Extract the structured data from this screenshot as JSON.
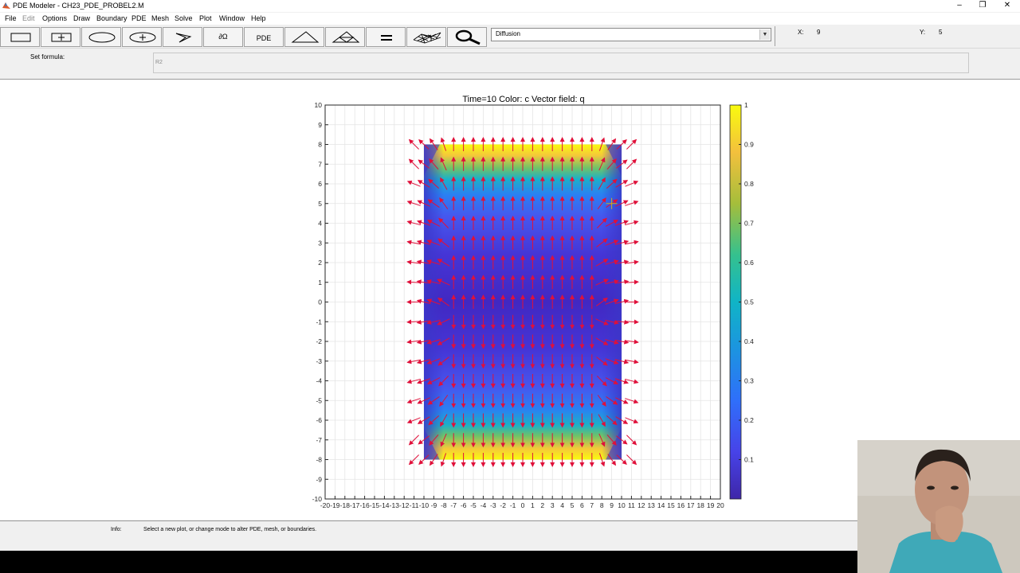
{
  "window": {
    "title": "PDE Modeler - CH23_PDE_PROBEL2.M",
    "controls": [
      "–",
      "❐",
      "✕"
    ]
  },
  "menubar": {
    "items": [
      "File",
      "Edit",
      "Options",
      "Draw",
      "Boundary",
      "PDE",
      "Mesh",
      "Solve",
      "Plot",
      "Window",
      "Help"
    ]
  },
  "toolbar": {
    "buttons": [
      {
        "name": "draw-rectangle-button",
        "icon": "rectangle-icon"
      },
      {
        "name": "draw-centered-rectangle-button",
        "icon": "centered-rectangle-icon"
      },
      {
        "name": "draw-ellipse-button",
        "icon": "ellipse-icon"
      },
      {
        "name": "draw-centered-ellipse-button",
        "icon": "centered-ellipse-icon"
      },
      {
        "name": "draw-polygon-button",
        "icon": "polygon-icon"
      },
      {
        "name": "boundary-mode-button",
        "icon": "boundary-icon",
        "label": "∂Ω"
      },
      {
        "name": "pde-specification-button",
        "icon": "pde-icon",
        "label": "PDE"
      },
      {
        "name": "initialize-mesh-button",
        "icon": "triangle-mesh-icon"
      },
      {
        "name": "refine-mesh-button",
        "icon": "refined-mesh-icon"
      },
      {
        "name": "solve-pde-button",
        "icon": "equals-icon"
      },
      {
        "name": "plot-solution-button",
        "icon": "surface-plot-icon"
      },
      {
        "name": "zoom-button",
        "icon": "zoom-icon"
      }
    ],
    "application_mode": "Diffusion"
  },
  "coordinates": {
    "x_label": "X:",
    "x_value": "9",
    "y_label": "Y:",
    "y_value": "5"
  },
  "formula": {
    "label": "Set formula:",
    "value": "R2"
  },
  "plot": {
    "title": "Time=10   Color: c   Vector field: q",
    "colorbar_ticks": [
      "0.1",
      "0.2",
      "0.3",
      "0.4",
      "0.5",
      "0.6",
      "0.7",
      "0.8",
      "0.9",
      "1"
    ],
    "arrow_color": "#e0103a",
    "cursor_color": "#c8b020"
  },
  "chart_data": {
    "type": "heatmap",
    "title": "Time=10   Color: c   Vector field: q",
    "xlabel": "",
    "ylabel": "",
    "xlim": [
      -20,
      20
    ],
    "ylim": [
      -10,
      10
    ],
    "x_ticks": [
      -20,
      -19,
      -18,
      -17,
      -16,
      -15,
      -14,
      -13,
      -12,
      -11,
      -10,
      -9,
      -8,
      -7,
      -6,
      -5,
      -4,
      -3,
      -2,
      -1,
      0,
      1,
      2,
      3,
      4,
      5,
      6,
      7,
      8,
      9,
      10,
      11,
      12,
      13,
      14,
      15,
      16,
      17,
      18,
      19,
      20
    ],
    "y_ticks": [
      -10,
      -9,
      -8,
      -7,
      -6,
      -5,
      -4,
      -3,
      -2,
      -1,
      0,
      1,
      2,
      3,
      4,
      5,
      6,
      7,
      8,
      9,
      10
    ],
    "grid": true,
    "domain_rect": {
      "xmin": -10,
      "xmax": 10,
      "ymin": -8,
      "ymax": 8
    },
    "colormap": "parula",
    "color_range": [
      0,
      1
    ],
    "color_profile": {
      "y": [
        0,
        2,
        4,
        5,
        6,
        6.5,
        7,
        7.5,
        8
      ],
      "c": [
        0.03,
        0.06,
        0.12,
        0.18,
        0.3,
        0.45,
        0.62,
        0.82,
        1.0
      ]
    },
    "vector_field": {
      "name": "q",
      "color": "red",
      "x_spacing": 1,
      "y_spacing": 1
    }
  },
  "info": {
    "label": "Info:",
    "text": "Select a new plot, or change mode to alter PDE, mesh, or boundaries."
  }
}
